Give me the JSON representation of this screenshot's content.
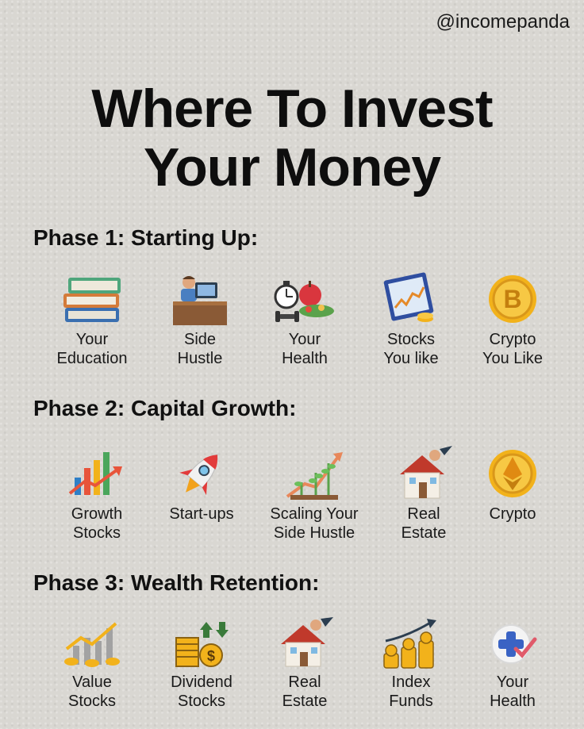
{
  "handle": "@incomepanda",
  "title": "Where To Invest\nYour Money",
  "phases": [
    {
      "heading": "Phase 1: Starting Up:",
      "items": [
        {
          "label": "Your\nEducation",
          "icon": "books-icon"
        },
        {
          "label": "Side\nHustle",
          "icon": "laptop-desk-icon"
        },
        {
          "label": "Your\nHealth",
          "icon": "health-food-icon"
        },
        {
          "label": "Stocks\nYou like",
          "icon": "stock-chart-icon"
        },
        {
          "label": "Crypto\nYou Like",
          "icon": "bitcoin-icon"
        }
      ]
    },
    {
      "heading": "Phase 2: Capital Growth:",
      "items": [
        {
          "label": "Growth\nStocks",
          "icon": "growth-chart-icon"
        },
        {
          "label": "Start-ups",
          "icon": "rocket-icon"
        },
        {
          "label": "Scaling Your\nSide Hustle",
          "icon": "growing-plant-icon"
        },
        {
          "label": "Real\nEstate",
          "icon": "house-icon"
        },
        {
          "label": "Crypto",
          "icon": "ethereum-icon"
        }
      ]
    },
    {
      "heading": "Phase 3: Wealth Retention:",
      "items": [
        {
          "label": "Value\nStocks",
          "icon": "coin-chart-icon"
        },
        {
          "label": "Dividend\nStocks",
          "icon": "dividend-icon"
        },
        {
          "label": "Real\nEstate",
          "icon": "house-icon"
        },
        {
          "label": "Index\nFunds",
          "icon": "coin-stacks-icon"
        },
        {
          "label": "Your\nHealth",
          "icon": "medical-cross-icon"
        }
      ]
    }
  ],
  "colors": {
    "background": "#d9d7d2",
    "text": "#111111",
    "coin_gold": "#f2b21b"
  }
}
